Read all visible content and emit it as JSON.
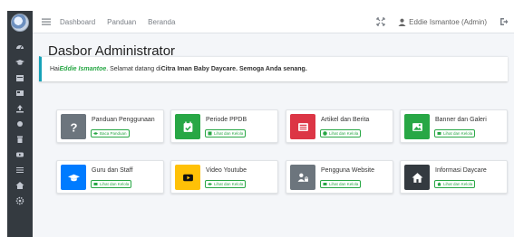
{
  "topbar": {
    "nav": [
      "Dashboard",
      "Panduan",
      "Beranda"
    ],
    "user": "Eddie Ismantoe (Admin)"
  },
  "page": {
    "title": "Dasbor Administrator"
  },
  "welcome": {
    "prefix": "Hai ",
    "name": "Eddie Ismantoe",
    "middle": ". Selamat datang di ",
    "org": "Citra Iman Baby Daycare",
    "suffix": " . Semoga Anda senang."
  },
  "cards": [
    {
      "title": "Panduan Penggunaan",
      "link": "Baca Panduan",
      "color": "#6c757d",
      "icon": "question-icon"
    },
    {
      "title": "Periode PPDB",
      "link": "Lihat dan Kelola",
      "color": "#28a745",
      "icon": "calendar-check-icon"
    },
    {
      "title": "Artikel dan Berita",
      "link": "Lihat dan Kelola",
      "color": "#dc3545",
      "icon": "newspaper-icon"
    },
    {
      "title": "Banner dan Galeri",
      "link": "Lihat dan Kelola",
      "color": "#28a745",
      "icon": "image-icon"
    },
    {
      "title": "Guru dan Staff",
      "link": "Lihat dan Kelola",
      "color": "#007bff",
      "icon": "graduation-cap-icon"
    },
    {
      "title": "Video Youtube",
      "link": "Lihat dan Kelola",
      "color": "#ffc107",
      "icon": "play-icon"
    },
    {
      "title": "Pengguna Website",
      "link": "Lihat dan Kelola",
      "color": "#6c757d",
      "icon": "users-lock-icon"
    },
    {
      "title": "Informasi Daycare",
      "link": "Lihat dan Kelola",
      "color": "#343a40",
      "icon": "home-icon"
    }
  ]
}
